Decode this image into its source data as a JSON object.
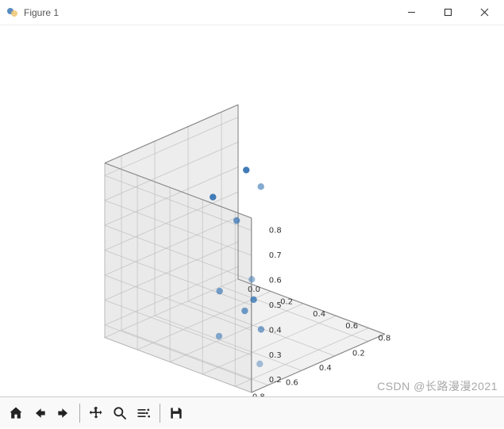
{
  "window": {
    "title": "Figure 1"
  },
  "toolbar": {
    "home": "Home",
    "back": "Back",
    "forward": "Forward",
    "pan": "Pan",
    "zoom": "Zoom",
    "configure": "Configure",
    "save": "Save"
  },
  "watermark": "CSDN @长路漫漫2021",
  "chart_data": {
    "type": "scatter",
    "projection": "3d",
    "title": "",
    "x_ticks": [
      0.2,
      0.4,
      0.6,
      0.8
    ],
    "y_ticks": [
      0.0,
      0.2,
      0.4,
      0.6,
      0.8
    ],
    "z_ticks": [
      0.2,
      0.3,
      0.4,
      0.5,
      0.6,
      0.7,
      0.8
    ],
    "xlim": [
      0.1,
      0.9
    ],
    "ylim": [
      0.0,
      0.9
    ],
    "zlim": [
      0.15,
      0.85
    ],
    "points": [
      {
        "x": 0.1,
        "y": 0.05,
        "z": 0.6
      },
      {
        "x": 0.3,
        "y": 0.05,
        "z": 0.55
      },
      {
        "x": 0.55,
        "y": 0.6,
        "z": 0.8
      },
      {
        "x": 0.5,
        "y": 0.4,
        "z": 0.6
      },
      {
        "x": 0.8,
        "y": 0.8,
        "z": 0.55
      },
      {
        "x": 0.7,
        "y": 0.5,
        "z": 0.4
      },
      {
        "x": 0.85,
        "y": 0.65,
        "z": 0.3
      },
      {
        "x": 0.85,
        "y": 0.9,
        "z": 0.25
      },
      {
        "x": 0.5,
        "y": 0.45,
        "z": 0.25
      },
      {
        "x": 0.3,
        "y": 0.3,
        "z": 0.2
      },
      {
        "x": 0.5,
        "y": 0.55,
        "z": 0.2
      }
    ],
    "marker_color": "#3b78b5"
  }
}
